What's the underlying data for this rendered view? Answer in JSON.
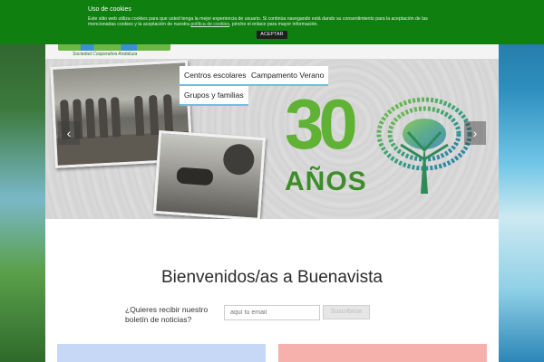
{
  "cookie": {
    "title": "Uso de cookies",
    "text": "Este sitio web utiliza cookies para que usted tenga la mejor experiencia de usuario. Si continúa navegando está dando su consentimiento para la aceptación de las mencionadas cookies y la aceptación de nuestra",
    "link": "política de cookies",
    "text_after": ", pinche el enlace para mayor información.",
    "accept_label": "ACEPTAR"
  },
  "logo": {
    "subtitle": "Sociedad Cooperativa Andaluza"
  },
  "menu": {
    "items": [
      {
        "label": "Centros escolares"
      },
      {
        "label": "Campamento Verano"
      },
      {
        "label": "Grupos y familias"
      }
    ]
  },
  "slider": {
    "number": "30",
    "word": "AÑOS",
    "prev_icon": "chevron-left-icon",
    "next_icon": "chevron-right-icon"
  },
  "welcome": {
    "title": "Bienvenidos/as a Buenavista"
  },
  "newsletter": {
    "label": "¿Quieres recibir nuestro boletín de noticias?",
    "email_placeholder": "aquí tu email",
    "subscribe_label": "Suscribirse"
  },
  "colors": {
    "cookie_bar": "#0f7f0f",
    "brand_green": "#5fb233",
    "menu_underline": "#6cc2dd",
    "card_blue": "#c7d8f6",
    "card_red": "#f6b1ac"
  }
}
